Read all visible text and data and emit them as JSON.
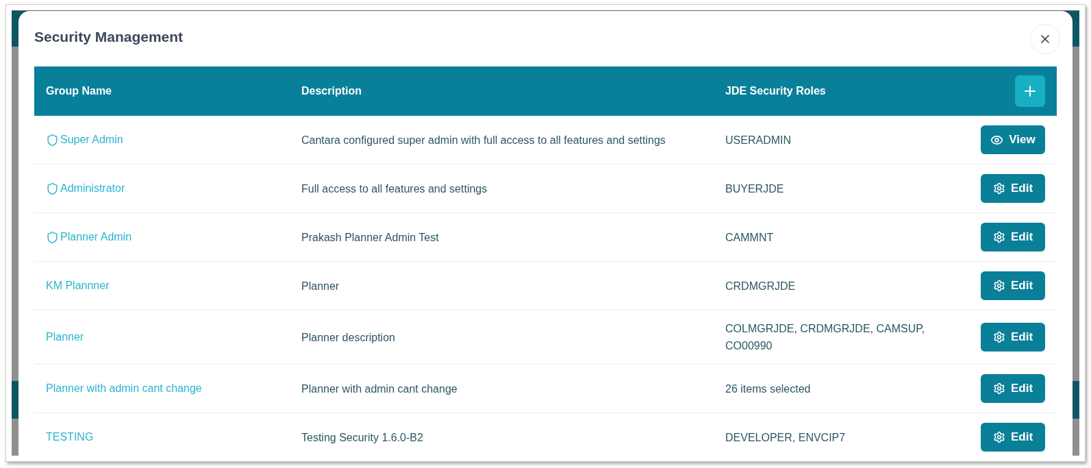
{
  "modal": {
    "title": "Security Management"
  },
  "table": {
    "columns": [
      "Group Name",
      "Description",
      "JDE Security Roles"
    ],
    "rows": [
      {
        "group_name": "Super Admin",
        "protected": true,
        "description": "Cantara configured super admin with full access to all features and settings",
        "roles": "USERADMIN",
        "action": {
          "kind": "view",
          "label": "View"
        }
      },
      {
        "group_name": "Administrator",
        "protected": true,
        "description": "Full access to all features and settings",
        "roles": "BUYERJDE",
        "action": {
          "kind": "edit",
          "label": "Edit"
        }
      },
      {
        "group_name": "Planner Admin",
        "protected": true,
        "description": "Prakash Planner Admin Test",
        "roles": "CAMMNT",
        "action": {
          "kind": "edit",
          "label": "Edit"
        }
      },
      {
        "group_name": "KM Plannner",
        "protected": false,
        "description": "Planner",
        "roles": "CRDMGRJDE",
        "action": {
          "kind": "edit",
          "label": "Edit"
        }
      },
      {
        "group_name": "Planner",
        "protected": false,
        "description": "Planner description",
        "roles": "COLMGRJDE, CRDMGRJDE, CAMSUP, CO00990",
        "action": {
          "kind": "edit",
          "label": "Edit"
        }
      },
      {
        "group_name": "Planner with admin cant change",
        "protected": false,
        "description": "Planner with admin cant change",
        "roles": "26 items selected",
        "action": {
          "kind": "edit",
          "label": "Edit"
        }
      },
      {
        "group_name": "TESTING",
        "protected": false,
        "description": "Testing Security 1.6.0-B2",
        "roles": "DEVELOPER, ENVCIP7",
        "action": {
          "kind": "edit",
          "label": "Edit"
        }
      }
    ]
  }
}
